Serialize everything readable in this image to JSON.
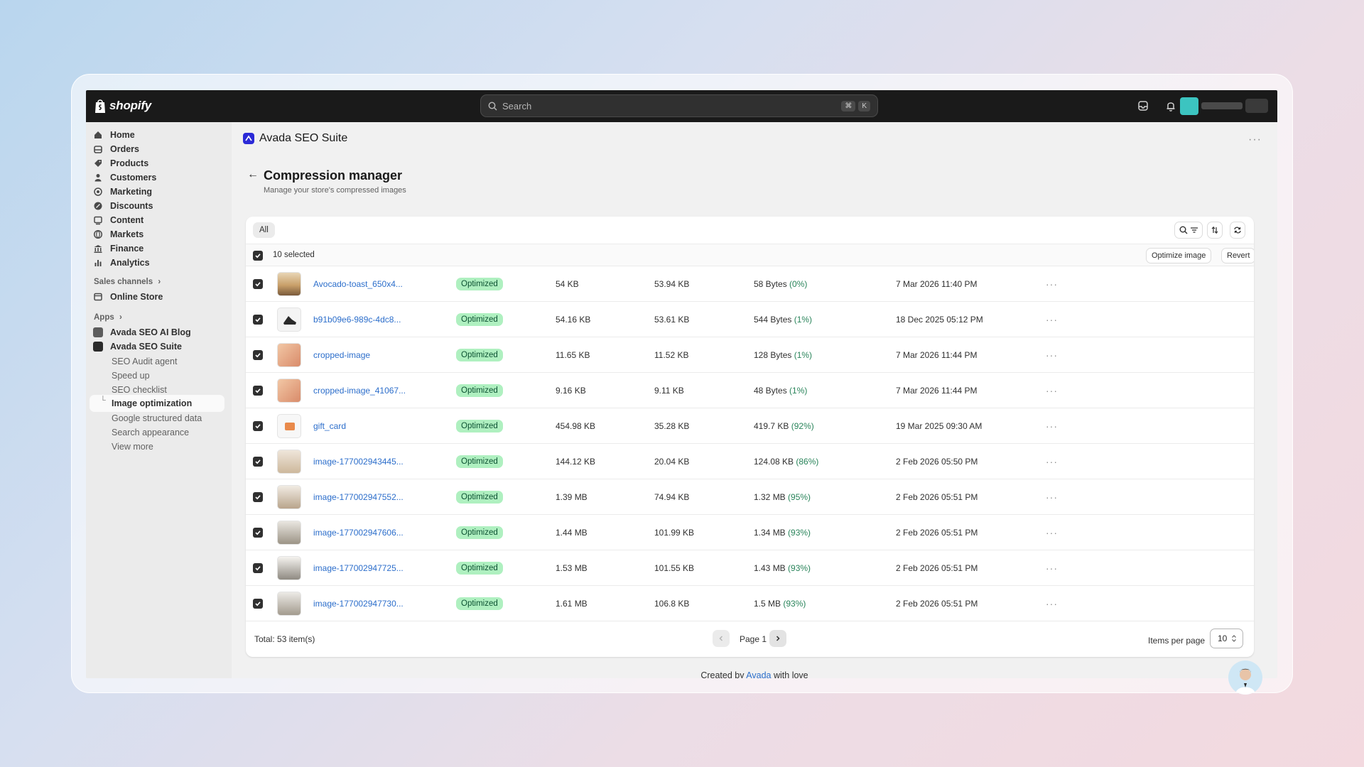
{
  "topbar": {
    "brand": "shopify",
    "search_placeholder": "Search",
    "shortcut_key1": "⌘",
    "shortcut_key2": "K"
  },
  "sidebar": {
    "items": [
      {
        "label": "Home",
        "icon": "home-icon"
      },
      {
        "label": "Orders",
        "icon": "orders-icon"
      },
      {
        "label": "Products",
        "icon": "tag-icon"
      },
      {
        "label": "Customers",
        "icon": "person-icon"
      },
      {
        "label": "Marketing",
        "icon": "target-icon"
      },
      {
        "label": "Discounts",
        "icon": "discount-icon"
      },
      {
        "label": "Content",
        "icon": "content-icon"
      },
      {
        "label": "Markets",
        "icon": "globe-icon"
      },
      {
        "label": "Finance",
        "icon": "bank-icon"
      },
      {
        "label": "Analytics",
        "icon": "chart-icon"
      }
    ],
    "sales_channels_label": "Sales channels",
    "online_store": "Online Store",
    "apps_label": "Apps",
    "apps": [
      "Avada SEO AI Blog",
      "Avada SEO Suite"
    ],
    "sub_items": [
      "SEO Audit agent",
      "Speed up",
      "SEO checklist",
      "Image optimization",
      "Google structured data",
      "Search appearance",
      "View more"
    ]
  },
  "header": {
    "app_title": "Avada SEO Suite",
    "page_title": "Compression manager",
    "page_subtitle": "Manage your store's compressed images"
  },
  "toolbar": {
    "tab_all": "All",
    "selected_text": "10 selected",
    "optimize_label": "Optimize image",
    "revert_label": "Revert"
  },
  "rows": [
    {
      "name": "Avocado-toast_650x4...",
      "status": "Optimized",
      "original": "54 KB",
      "compressed": "53.94 KB",
      "saved": "58 Bytes",
      "pct": "(0%)",
      "date": "7 Mar 2026 11:40 PM"
    },
    {
      "name": "b91b09e6-989c-4dc8...",
      "status": "Optimized",
      "original": "54.16 KB",
      "compressed": "53.61 KB",
      "saved": "544 Bytes",
      "pct": "(1%)",
      "date": "18 Dec 2025 05:12 PM"
    },
    {
      "name": "cropped-image",
      "status": "Optimized",
      "original": "11.65 KB",
      "compressed": "11.52 KB",
      "saved": "128 Bytes",
      "pct": "(1%)",
      "date": "7 Mar 2026 11:44 PM"
    },
    {
      "name": "cropped-image_41067...",
      "status": "Optimized",
      "original": "9.16 KB",
      "compressed": "9.11 KB",
      "saved": "48 Bytes",
      "pct": "(1%)",
      "date": "7 Mar 2026 11:44 PM"
    },
    {
      "name": "gift_card",
      "status": "Optimized",
      "original": "454.98 KB",
      "compressed": "35.28 KB",
      "saved": "419.7 KB",
      "pct": "(92%)",
      "date": "19 Mar 2025 09:30 AM"
    },
    {
      "name": "image-177002943445...",
      "status": "Optimized",
      "original": "144.12 KB",
      "compressed": "20.04 KB",
      "saved": "124.08 KB",
      "pct": "(86%)",
      "date": "2 Feb 2026 05:50 PM"
    },
    {
      "name": "image-177002947552...",
      "status": "Optimized",
      "original": "1.39 MB",
      "compressed": "74.94 KB",
      "saved": "1.32 MB",
      "pct": "(95%)",
      "date": "2 Feb 2026 05:51 PM"
    },
    {
      "name": "image-177002947606...",
      "status": "Optimized",
      "original": "1.44 MB",
      "compressed": "101.99 KB",
      "saved": "1.34 MB",
      "pct": "(93%)",
      "date": "2 Feb 2026 05:51 PM"
    },
    {
      "name": "image-177002947725...",
      "status": "Optimized",
      "original": "1.53 MB",
      "compressed": "101.55 KB",
      "saved": "1.43 MB",
      "pct": "(93%)",
      "date": "2 Feb 2026 05:51 PM"
    },
    {
      "name": "image-177002947730...",
      "status": "Optimized",
      "original": "1.61 MB",
      "compressed": "106.8 KB",
      "saved": "1.5 MB",
      "pct": "(93%)",
      "date": "2 Feb 2026 05:51 PM"
    }
  ],
  "footer": {
    "total": "Total: 53 item(s)",
    "page_label": "Page 1",
    "items_per_page_label": "Items per page",
    "items_per_page_value": "10",
    "credit_prefix": "Created by",
    "credit_link": "Avada",
    "credit_suffix": "with love"
  },
  "colors": {
    "accent_link": "#2c6ecb",
    "badge_bg": "#aff0c0",
    "badge_text": "#0c5132",
    "pct_green": "#29845a",
    "topbar": "#1a1a1a"
  }
}
